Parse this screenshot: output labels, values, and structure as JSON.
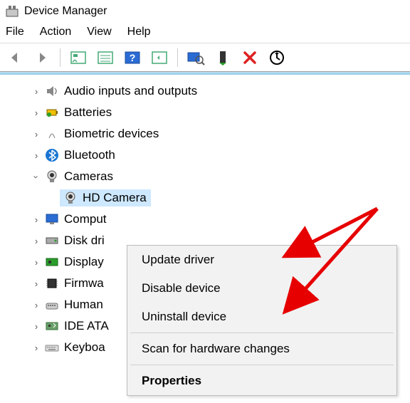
{
  "window": {
    "title": "Device Manager"
  },
  "menubar": {
    "items": [
      "File",
      "Action",
      "View",
      "Help"
    ]
  },
  "tree": {
    "nodes": [
      {
        "label": "Audio inputs and outputs",
        "expanded": false
      },
      {
        "label": "Batteries",
        "expanded": false
      },
      {
        "label": "Biometric devices",
        "expanded": false
      },
      {
        "label": "Bluetooth",
        "expanded": false
      },
      {
        "label": "Cameras",
        "expanded": true,
        "children": [
          {
            "label": "HD Camera",
            "selected": true
          }
        ]
      },
      {
        "label": "Computers",
        "expanded": false
      },
      {
        "label": "Disk drives",
        "expanded": false
      },
      {
        "label": "Display adapters",
        "expanded": false
      },
      {
        "label": "Firmware",
        "expanded": false
      },
      {
        "label": "Human Interface Devices",
        "expanded": false
      },
      {
        "label": "IDE ATA/ATAPI controllers",
        "expanded": false
      },
      {
        "label": "Keyboards",
        "expanded": false
      }
    ]
  },
  "context_menu": {
    "items": [
      "Update driver",
      "Disable device",
      "Uninstall device",
      "Scan for hardware changes",
      "Properties"
    ]
  },
  "truncated_labels": {
    "computers": "Comput",
    "disk": "Disk dri",
    "display": "Display",
    "firmware": "Firmwa",
    "human": "Human",
    "ide": "IDE ATA",
    "keyboards": "Keyboa"
  }
}
